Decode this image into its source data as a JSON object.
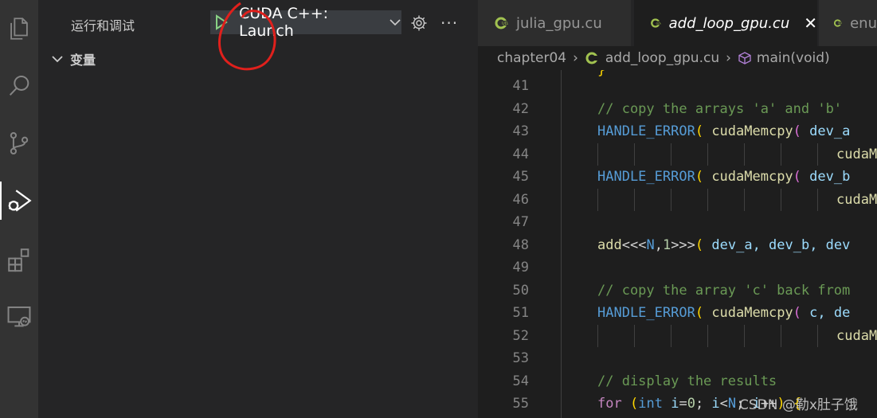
{
  "sidebar": {
    "title": "运行和调试",
    "config_label": "CUDA C++: Launch",
    "section_label": "变量"
  },
  "tabs": [
    {
      "label": "julia_gpu.cu"
    },
    {
      "label": "add_loop_gpu.cu"
    },
    {
      "label": "enu"
    }
  ],
  "breadcrumb": {
    "folder": "chapter04",
    "file": "add_loop_gpu.cu",
    "symbol": "main(void)"
  },
  "editor": {
    "line_numbers": [
      "41",
      "42",
      "43",
      "44",
      "45",
      "46",
      "47",
      "48",
      "49",
      "50",
      "51",
      "52",
      "53",
      "54",
      "55"
    ],
    "lines": {
      "l42": "// copy the arrays 'a' and 'b'",
      "l43_a": "HANDLE_ERROR",
      "l43_b": "cudaMemcpy",
      "l43_c": "dev_a",
      "l44": "cudaM",
      "l45_a": "HANDLE_ERROR",
      "l45_b": "cudaMemcpy",
      "l45_c": "dev_b",
      "l46": "cudaM",
      "l48_fn": "add",
      "l48_n": "N",
      "l48_one": "1",
      "l48_args": "dev_a, dev_b, dev",
      "l50": "// copy the array 'c' back from",
      "l51_a": "HANDLE_ERROR",
      "l51_b": "cudaMemcpy",
      "l51_c": "c, de",
      "l52": "cudaM",
      "l54": "// display the results",
      "l55_for": "for",
      "l55_int": "int",
      "l55_i": "i",
      "l55_zero": "0",
      "l55_i2": "i",
      "l55_n": "N",
      "l55_i3": "i"
    }
  },
  "watermark": "CSDN @勒x肚子饿",
  "colors": {
    "annotation_circle": "#e0201c",
    "run_icon": "#89d185"
  }
}
